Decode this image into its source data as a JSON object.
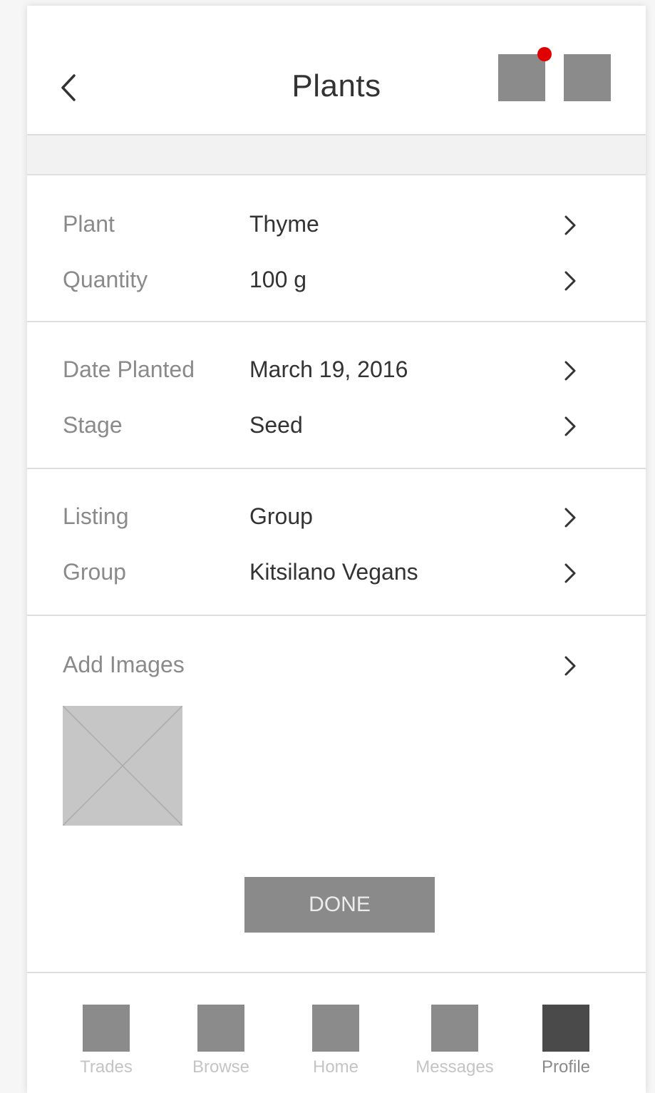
{
  "header": {
    "title": "Plants",
    "back_icon": "chevron-left-icon",
    "notification_color": "#e00000"
  },
  "sections": [
    {
      "rows": [
        {
          "label": "Plant",
          "value": "Thyme"
        },
        {
          "label": "Quantity",
          "value": "100 g"
        }
      ]
    },
    {
      "rows": [
        {
          "label": "Date Planted",
          "value": "March 19, 2016"
        },
        {
          "label": "Stage",
          "value": "Seed"
        }
      ]
    },
    {
      "rows": [
        {
          "label": "Listing",
          "value": "Group"
        },
        {
          "label": "Group",
          "value": "Kitsilano Vegans"
        }
      ]
    }
  ],
  "images": {
    "label": "Add Images",
    "placeholder_icon": "image-placeholder-icon"
  },
  "done_label": "DONE",
  "tabs": [
    {
      "label": "Trades",
      "active": false
    },
    {
      "label": "Browse",
      "active": false
    },
    {
      "label": "Home",
      "active": false
    },
    {
      "label": "Messages",
      "active": false
    },
    {
      "label": "Profile",
      "active": true
    }
  ]
}
